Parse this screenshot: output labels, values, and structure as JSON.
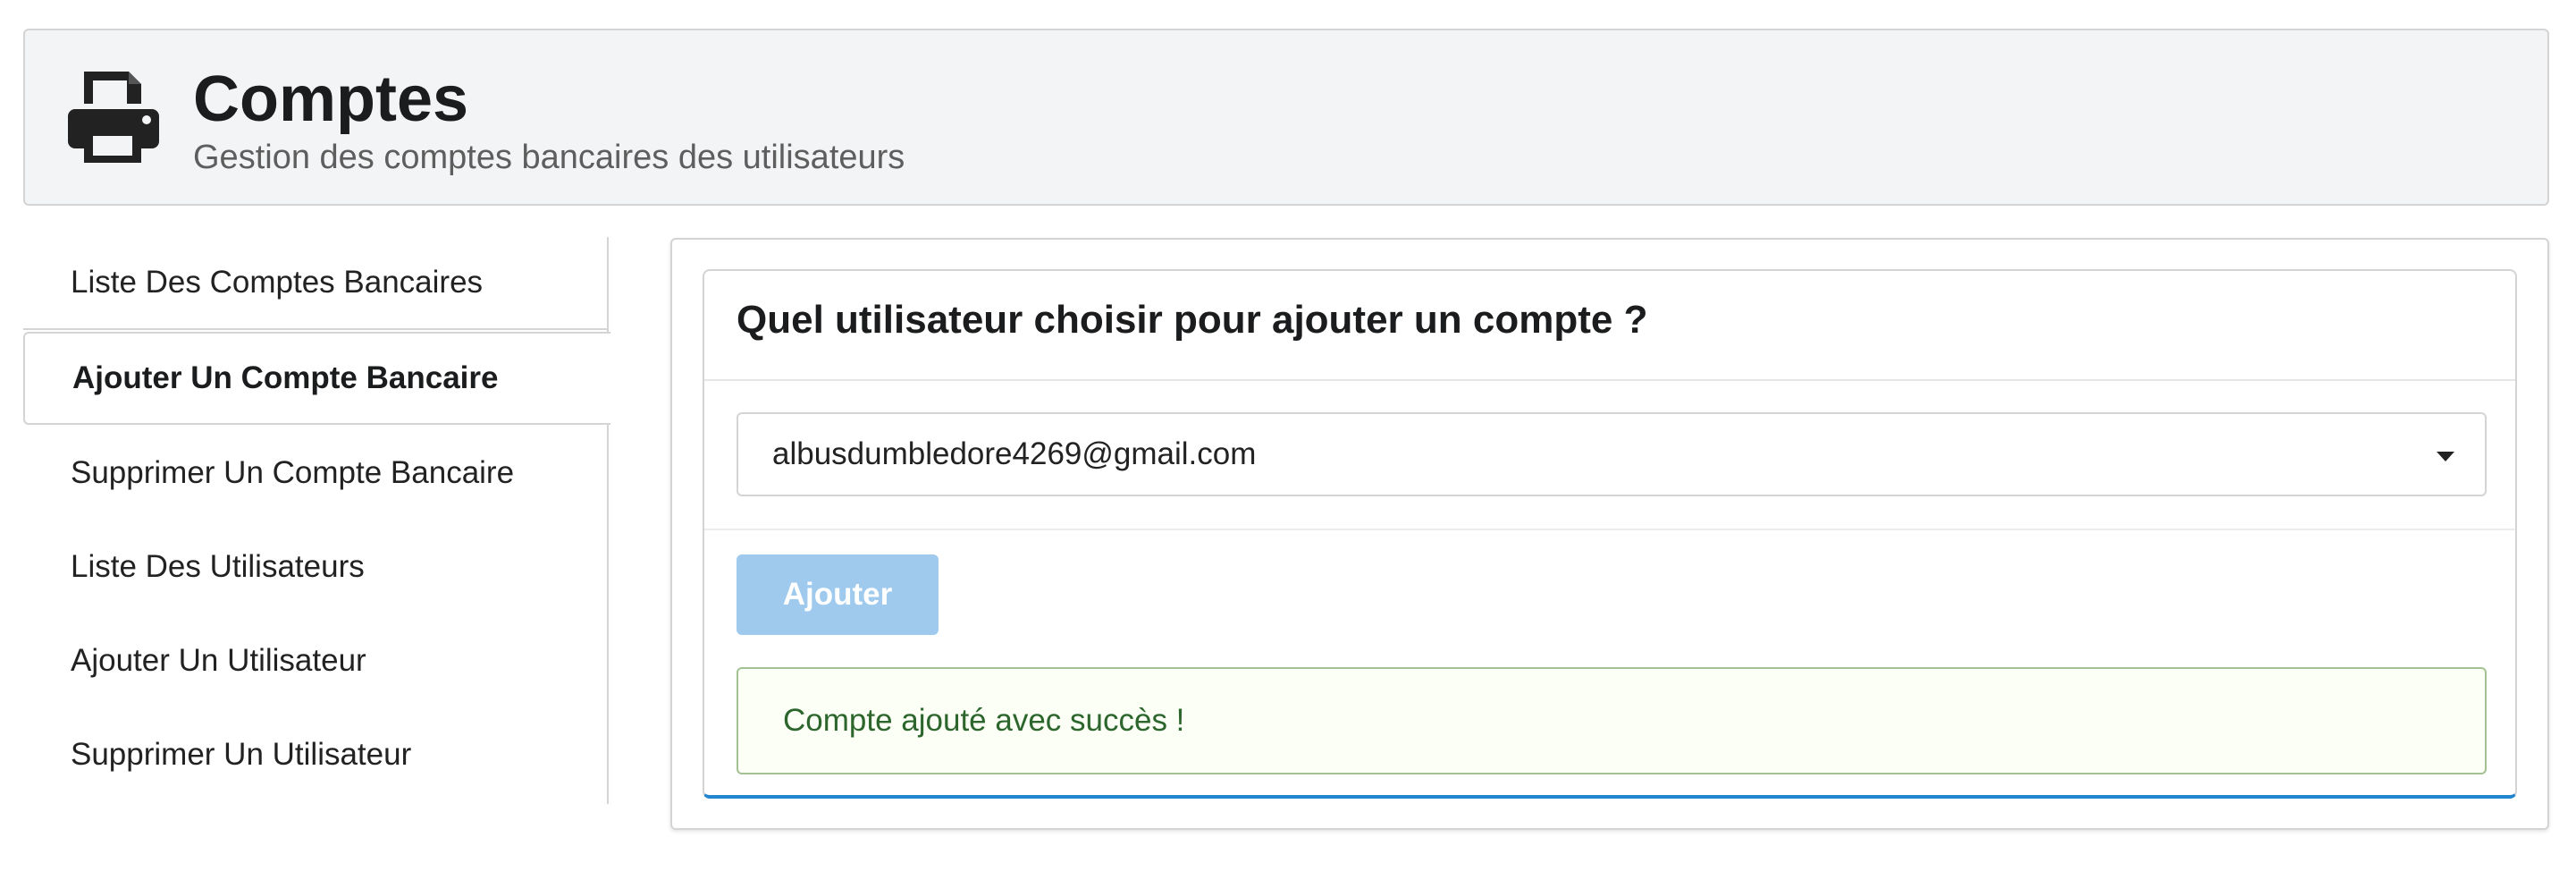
{
  "header": {
    "icon": "printer-icon",
    "title": "Comptes",
    "subtitle": "Gestion des comptes bancaires des utilisateurs"
  },
  "sidebar": {
    "items": [
      {
        "label": "Liste Des Comptes Bancaires",
        "active": false
      },
      {
        "label": "Ajouter Un Compte Bancaire",
        "active": true
      },
      {
        "label": "Supprimer Un Compte Bancaire",
        "active": false
      },
      {
        "label": "Liste Des Utilisateurs",
        "active": false
      },
      {
        "label": "Ajouter Un Utilisateur",
        "active": false
      },
      {
        "label": "Supprimer Un Utilisateur",
        "active": false
      }
    ]
  },
  "main": {
    "card_title": "Quel utilisateur choisir pour ajouter un compte ?",
    "user_select": {
      "selected_value": "albusdumbledore4269@gmail.com",
      "caret_icon": "caret-down-icon"
    },
    "add_button_label": "Ajouter",
    "success_message": "Compte ajouté avec succès !"
  },
  "colors": {
    "accent": "#2185d0",
    "button_disabled": "#9fcaee",
    "success_bg": "#fcfff5",
    "success_border": "#a3c293",
    "success_text": "#2c662d",
    "header_bg": "#f3f4f5"
  }
}
